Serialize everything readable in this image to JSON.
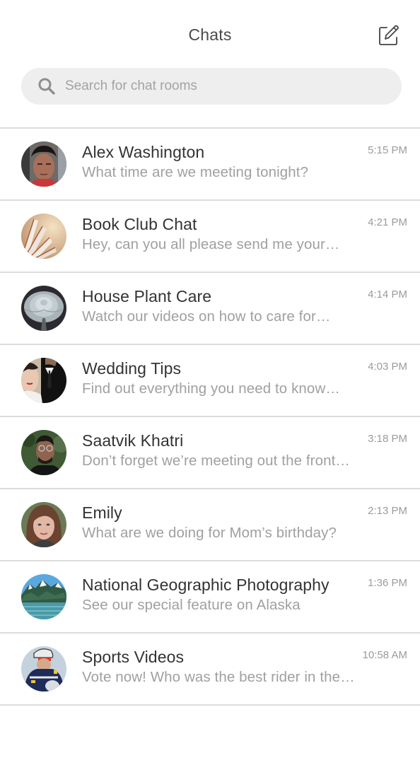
{
  "header": {
    "title": "Chats",
    "compose_icon": "compose-edit-icon"
  },
  "search": {
    "placeholder": "Search for chat rooms",
    "value": "",
    "icon": "search-icon"
  },
  "colors": {
    "title": "#4a4a4a",
    "name": "#333333",
    "preview": "#a0a0a0",
    "time": "#9b9b9b",
    "search_bg": "#eeeeee",
    "divider": "#dcdcdc"
  },
  "chats": [
    {
      "name": "Alex Washington",
      "preview": "What time are we meeting tonight?",
      "time": "5:15 PM",
      "avatar": "person-photo"
    },
    {
      "name": "Book Club Chat",
      "preview": "Hey, can you all please send me your…",
      "time": "4:21 PM",
      "avatar": "book-pages-photo"
    },
    {
      "name": "House Plant Care",
      "preview": "Watch our videos on how to care for…",
      "time": "4:14 PM",
      "avatar": "succulent-photo"
    },
    {
      "name": "Wedding Tips",
      "preview": "Find out everything you need to know…",
      "time": "4:03 PM",
      "avatar": "wedding-couple-photo"
    },
    {
      "name": "Saatvik Khatri",
      "preview": "Don’t forget we’re meeting out the front…",
      "time": "3:18 PM",
      "avatar": "person-photo"
    },
    {
      "name": "Emily",
      "preview": "What are we doing for Mom’s birthday?",
      "time": "2:13 PM",
      "avatar": "person-photo"
    },
    {
      "name": "National Geographic Photography",
      "preview": "See our special feature on Alaska",
      "time": "1:36 PM",
      "avatar": "mountain-landscape-photo"
    },
    {
      "name": "Sports Videos",
      "preview": "Vote now! Who was the best rider in the…",
      "time": "10:58 AM",
      "avatar": "cyclist-photo"
    }
  ]
}
